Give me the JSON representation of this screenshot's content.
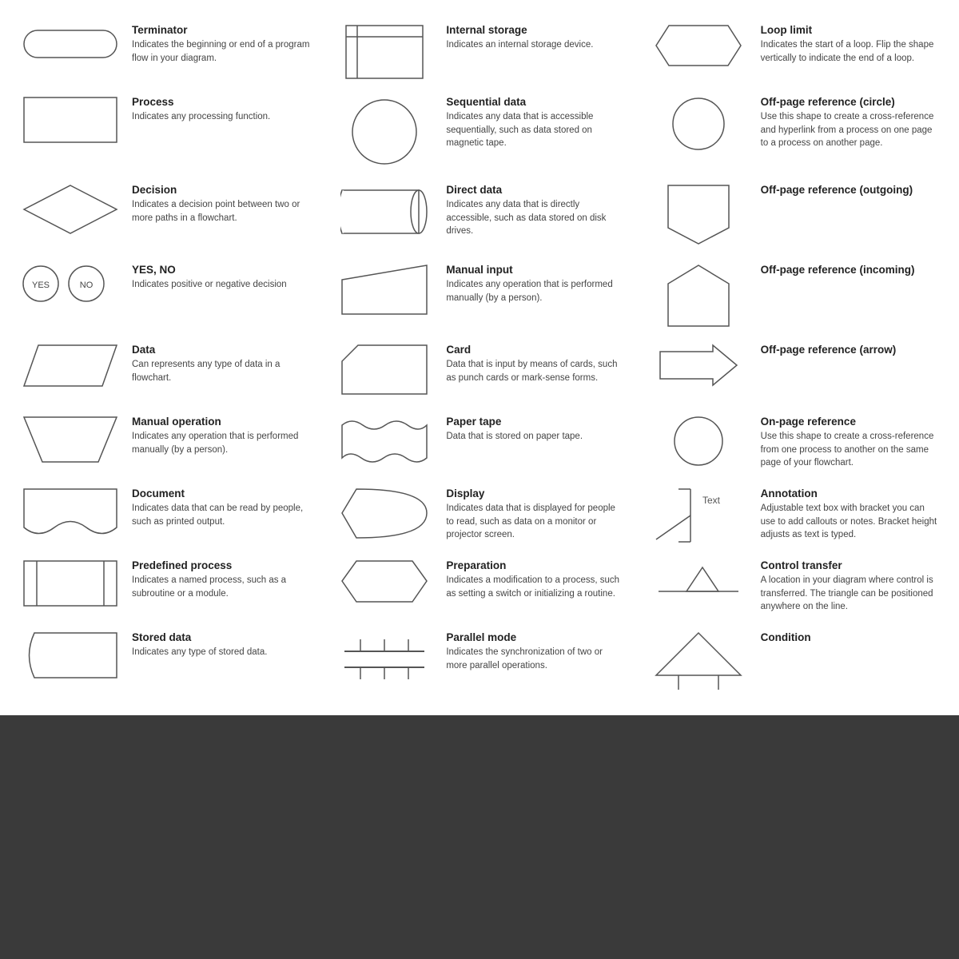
{
  "items": [
    {
      "id": "terminator",
      "title": "Terminator",
      "desc": "Indicates the beginning or end of a program flow in your diagram.",
      "col": 0,
      "row": 0
    },
    {
      "id": "process",
      "title": "Process",
      "desc": "Indicates any processing function.",
      "col": 0,
      "row": 1
    },
    {
      "id": "decision",
      "title": "Decision",
      "desc": "Indicates a decision point between two or more paths in a flowchart.",
      "col": 0,
      "row": 2
    },
    {
      "id": "yes-no",
      "title": "YES, NO",
      "desc": "Indicates positive or negative decision",
      "col": 0,
      "row": 3
    },
    {
      "id": "data",
      "title": "Data",
      "desc": "Can represents any type of data in a flowchart.",
      "col": 0,
      "row": 4
    },
    {
      "id": "manual-operation",
      "title": "Manual operation",
      "desc": "Indicates any operation that is performed manually (by a person).",
      "col": 0,
      "row": 5
    },
    {
      "id": "document",
      "title": "Document",
      "desc": "Indicates data that can be read by people, such as printed output.",
      "col": 0,
      "row": 6
    },
    {
      "id": "predefined-process",
      "title": "Predefined process",
      "desc": "Indicates a named process, such as a subroutine or a module.",
      "col": 0,
      "row": 7
    },
    {
      "id": "stored-data",
      "title": "Stored data",
      "desc": "Indicates any type of stored data.",
      "col": 0,
      "row": 8
    },
    {
      "id": "internal-storage",
      "title": "Internal storage",
      "desc": "Indicates an internal storage device.",
      "col": 1,
      "row": 0
    },
    {
      "id": "sequential-data",
      "title": "Sequential data",
      "desc": "Indicates any data that is accessible sequentially, such as data stored on magnetic tape.",
      "col": 1,
      "row": 1
    },
    {
      "id": "direct-data",
      "title": "Direct data",
      "desc": "Indicates any data that is directly accessible, such as data stored on disk drives.",
      "col": 1,
      "row": 2
    },
    {
      "id": "manual-input",
      "title": "Manual input",
      "desc": "Indicates any operation that is performed manually (by a person).",
      "col": 1,
      "row": 3
    },
    {
      "id": "card",
      "title": "Card",
      "desc": "Data that is input by means of cards, such as punch cards or mark-sense forms.",
      "col": 1,
      "row": 4
    },
    {
      "id": "paper-tape",
      "title": "Paper tape",
      "desc": "Data that is stored on paper tape.",
      "col": 1,
      "row": 5
    },
    {
      "id": "display",
      "title": "Display",
      "desc": "Indicates data that is displayed for people to read, such as data on a monitor or projector screen.",
      "col": 1,
      "row": 6
    },
    {
      "id": "preparation",
      "title": "Preparation",
      "desc": "Indicates a modification to a process, such as setting a switch or initializing a routine.",
      "col": 1,
      "row": 7
    },
    {
      "id": "parallel-mode",
      "title": "Parallel mode",
      "desc": "Indicates the synchronization of two or more parallel operations.",
      "col": 1,
      "row": 8
    },
    {
      "id": "loop-limit",
      "title": "Loop limit",
      "desc": "Indicates the start of a loop. Flip the shape vertically to indicate the end of a loop.",
      "col": 2,
      "row": 0
    },
    {
      "id": "off-page-circle",
      "title": "Off-page reference (circle)",
      "desc": "Use this shape to create a cross-reference and hyperlink from a process on one page to a process on another page.",
      "col": 2,
      "row": 1
    },
    {
      "id": "off-page-outgoing",
      "title": "Off-page reference (outgoing)",
      "desc": "",
      "col": 2,
      "row": 2
    },
    {
      "id": "off-page-incoming",
      "title": "Off-page reference (incoming)",
      "desc": "",
      "col": 2,
      "row": 3
    },
    {
      "id": "off-page-arrow",
      "title": "Off-page reference (arrow)",
      "desc": "",
      "col": 2,
      "row": 4
    },
    {
      "id": "on-page-reference",
      "title": "On-page reference",
      "desc": "Use this shape to create a cross-reference from one process to another on the same page of your flowchart.",
      "col": 2,
      "row": 5
    },
    {
      "id": "annotation",
      "title": "Annotation",
      "desc": "Adjustable text box with bracket you can use to add callouts or notes. Bracket height adjusts as text is typed.",
      "col": 2,
      "row": 6
    },
    {
      "id": "control-transfer",
      "title": "Control transfer",
      "desc": "A location in your diagram where control is transferred. The triangle can be positioned anywhere on the line.",
      "col": 2,
      "row": 7
    },
    {
      "id": "condition",
      "title": "Condition",
      "desc": "",
      "col": 2,
      "row": 8
    }
  ]
}
